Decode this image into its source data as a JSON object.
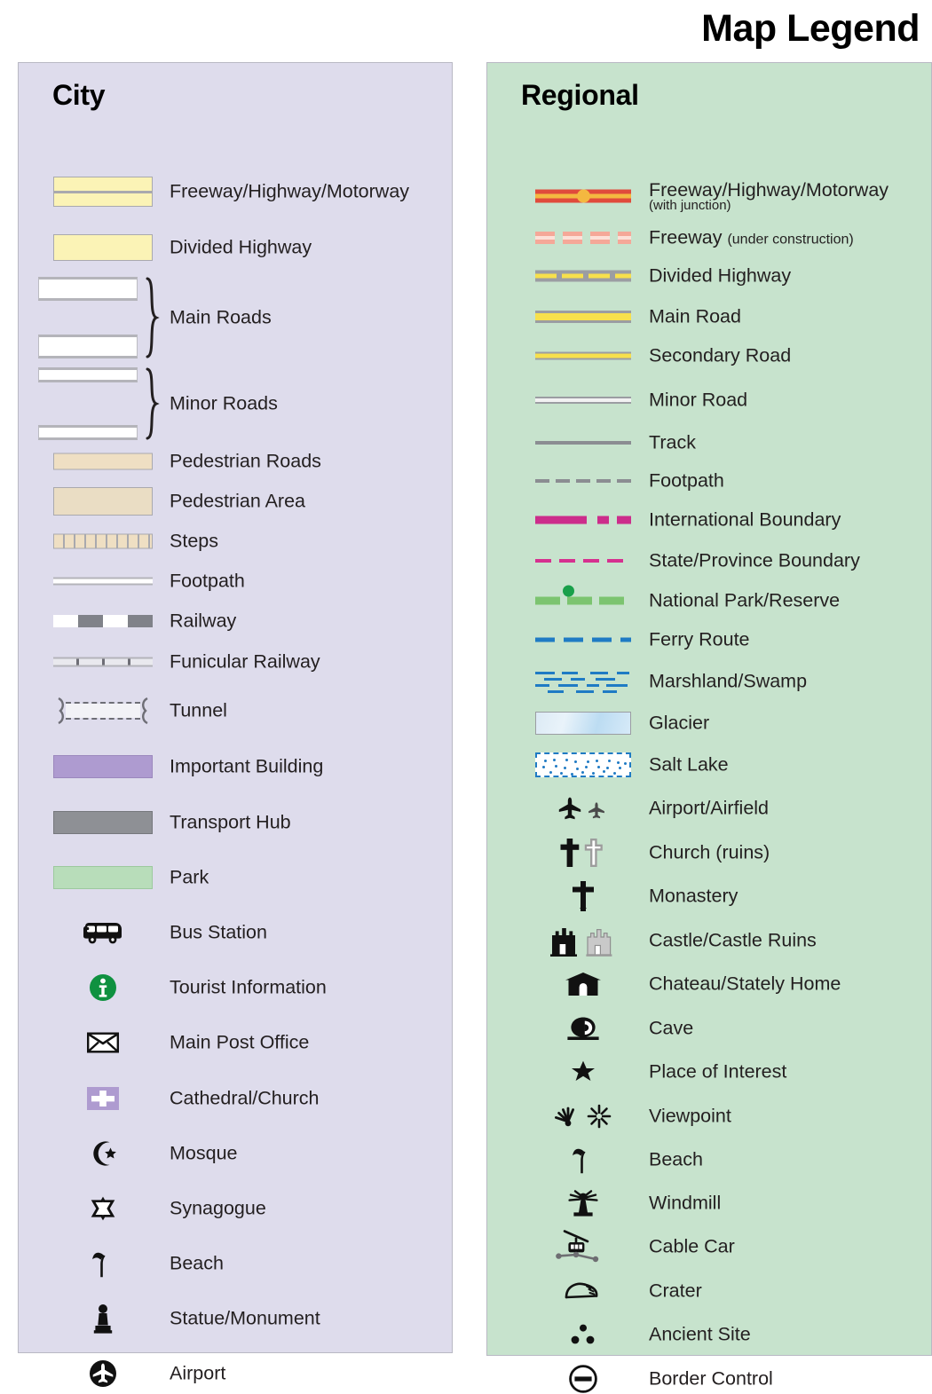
{
  "title": "Map Legend",
  "panels": {
    "city": {
      "heading": "City",
      "background_color": "#dedcec",
      "items": [
        {
          "label": "Freeway/Highway/Motorway",
          "symbol": "city-freeway-swatch"
        },
        {
          "label": "Divided Highway",
          "symbol": "city-divided-highway-swatch"
        },
        {
          "label": "Main Roads",
          "symbol": "city-main-roads-braced-swatch"
        },
        {
          "label": "Minor Roads",
          "symbol": "city-minor-roads-braced-swatch"
        },
        {
          "label": "Pedestrian Roads",
          "symbol": "city-pedestrian-road-swatch"
        },
        {
          "label": "Pedestrian Area",
          "symbol": "city-pedestrian-area-swatch"
        },
        {
          "label": "Steps",
          "symbol": "city-steps-swatch"
        },
        {
          "label": "Footpath",
          "symbol": "city-footpath-swatch"
        },
        {
          "label": "Railway",
          "symbol": "city-railway-swatch"
        },
        {
          "label": "Funicular Railway",
          "symbol": "city-funicular-railway-swatch"
        },
        {
          "label": "Tunnel",
          "symbol": "city-tunnel-swatch"
        },
        {
          "label": "Important Building",
          "symbol": "city-important-building-swatch"
        },
        {
          "label": "Transport Hub",
          "symbol": "city-transport-hub-swatch"
        },
        {
          "label": "Park",
          "symbol": "city-park-swatch"
        },
        {
          "label": "Bus Station",
          "symbol": "bus-icon"
        },
        {
          "label": "Tourist Information",
          "symbol": "information-icon"
        },
        {
          "label": "Main Post Office",
          "symbol": "envelope-icon"
        },
        {
          "label": "Cathedral/Church",
          "symbol": "cross-on-purple-icon"
        },
        {
          "label": "Mosque",
          "symbol": "crescent-star-icon"
        },
        {
          "label": "Synagogue",
          "symbol": "star-of-david-icon"
        },
        {
          "label": "Beach",
          "symbol": "beach-umbrella-icon"
        },
        {
          "label": "Statue/Monument",
          "symbol": "statue-icon"
        },
        {
          "label": "Airport",
          "symbol": "airplane-circle-icon"
        }
      ]
    },
    "regional": {
      "heading": "Regional",
      "background_color": "#c7e3cd",
      "items": [
        {
          "label": "Freeway/Highway/Motorway",
          "sublabel": "(with junction)",
          "sublabel_position": "below",
          "symbol": "regional-freeway-junction-line"
        },
        {
          "label": "Freeway",
          "sublabel": "(under construction)",
          "sublabel_position": "inline",
          "symbol": "regional-freeway-under-construction-line"
        },
        {
          "label": "Divided Highway",
          "symbol": "regional-divided-highway-line"
        },
        {
          "label": "Main Road",
          "symbol": "regional-main-road-line"
        },
        {
          "label": "Secondary Road",
          "symbol": "regional-secondary-road-line"
        },
        {
          "label": "Minor Road",
          "symbol": "regional-minor-road-line"
        },
        {
          "label": "Track",
          "symbol": "regional-track-line"
        },
        {
          "label": "Footpath",
          "symbol": "regional-footpath-line"
        },
        {
          "label": "International Boundary",
          "symbol": "regional-international-boundary-line"
        },
        {
          "label": "State/Province Boundary",
          "symbol": "regional-state-boundary-line"
        },
        {
          "label": "National Park/Reserve",
          "symbol": "regional-national-park-line"
        },
        {
          "label": "Ferry Route",
          "symbol": "regional-ferry-route-line"
        },
        {
          "label": "Marshland/Swamp",
          "symbol": "regional-marshland-pattern"
        },
        {
          "label": "Glacier",
          "symbol": "regional-glacier-swatch"
        },
        {
          "label": "Salt Lake",
          "symbol": "regional-salt-lake-swatch"
        },
        {
          "label": "Airport/Airfield",
          "symbol": "airplane-pair-icon"
        },
        {
          "label": "Church (ruins)",
          "symbol": "cross-pair-icon"
        },
        {
          "label": "Monastery",
          "symbol": "orthodox-cross-icon"
        },
        {
          "label": "Castle/Castle Ruins",
          "symbol": "castle-pair-icon"
        },
        {
          "label": "Chateau/Stately Home",
          "symbol": "chateau-icon"
        },
        {
          "label": "Cave",
          "symbol": "cave-icon"
        },
        {
          "label": "Place of Interest",
          "symbol": "star-icon"
        },
        {
          "label": "Viewpoint",
          "symbol": "viewpoint-pair-icon"
        },
        {
          "label": "Beach",
          "symbol": "beach-umbrella-icon"
        },
        {
          "label": "Windmill",
          "symbol": "windmill-icon"
        },
        {
          "label": "Cable Car",
          "symbol": "cable-car-icon"
        },
        {
          "label": "Crater",
          "symbol": "crater-icon"
        },
        {
          "label": "Ancient Site",
          "symbol": "ancient-site-icon"
        },
        {
          "label": "Border Control",
          "symbol": "border-control-icon"
        }
      ]
    }
  },
  "colors": {
    "city_panel": "#dedcec",
    "regional_panel": "#c7e3cd",
    "freeway_yellow": "#fbf3b6",
    "regional_freeway_red": "#e04b3c",
    "junction_orange": "#f4b840",
    "road_yellow": "#f7e04c",
    "boundary_magenta": "#cc2d8b",
    "park_green": "#7cc470",
    "ferry_blue": "#1f7bc4",
    "important_building_purple": "#ae9bd0",
    "transport_hub_gray": "#8e9095",
    "park_swatch_green": "#b8ddba",
    "pedestrian_tan": "#eaddc4",
    "tourist_info_green": "#19a04a"
  }
}
